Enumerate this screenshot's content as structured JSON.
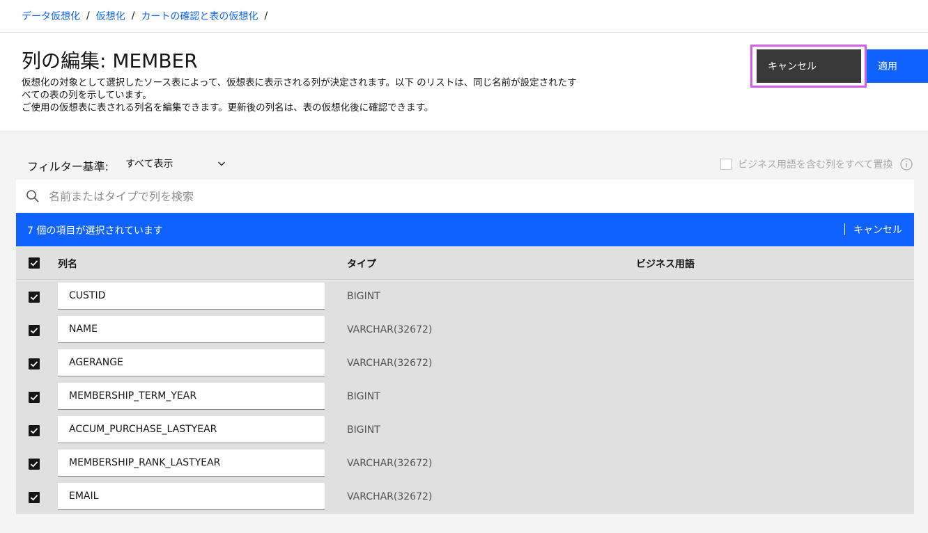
{
  "breadcrumb": [
    {
      "label": "データ仮想化"
    },
    {
      "label": "仮想化"
    },
    {
      "label": "カートの確認と表の仮想化"
    }
  ],
  "breadcrumb_separator": "/",
  "header": {
    "title": "列の編集: MEMBER",
    "description_line1": "仮想化の対象として選択したソース表によって、仮想表に表示される列が決定されます。以下 のリストは、同じ名前が設定されたす",
    "description_line2": "べての表の列を示しています。",
    "description_line3": "ご使用の仮想表に表される列名を編集できます。更新後の列名は、表の仮想化後に確認できます。",
    "cancel_label": "キャンセル",
    "apply_label": "適用"
  },
  "filter": {
    "label": "フィルター基準:",
    "selected": "すべて表示"
  },
  "replace_option": {
    "label": "ビジネス用語を含む列をすべて置換",
    "checked": false
  },
  "search": {
    "placeholder": "名前またはタイプで列を検索"
  },
  "batch": {
    "selected_text": "7 個の項目が選択されています",
    "cancel_label": "キャンセル"
  },
  "table": {
    "headers": {
      "name": "列名",
      "type": "タイプ",
      "business_term": "ビジネス用語"
    },
    "rows": [
      {
        "name": "CUSTID",
        "type": "BIGINT",
        "term": ""
      },
      {
        "name": "NAME",
        "type": "VARCHAR(32672)",
        "term": ""
      },
      {
        "name": "AGERANGE",
        "type": "VARCHAR(32672)",
        "term": ""
      },
      {
        "name": "MEMBERSHIP_TERM_YEAR",
        "type": "BIGINT",
        "term": ""
      },
      {
        "name": "ACCUM_PURCHASE_LASTYEAR",
        "type": "BIGINT",
        "term": ""
      },
      {
        "name": "MEMBERSHIP_RANK_LASTYEAR",
        "type": "VARCHAR(32672)",
        "term": ""
      },
      {
        "name": "EMAIL",
        "type": "VARCHAR(32672)",
        "term": ""
      }
    ]
  },
  "colors": {
    "primary": "#0f62fe",
    "secondary_button": "#393939",
    "focus_ring": "#d35ee8"
  }
}
